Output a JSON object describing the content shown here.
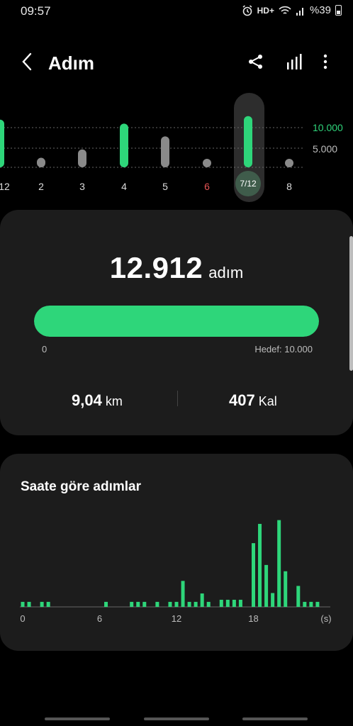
{
  "status": {
    "time": "09:57",
    "network": "HD+",
    "battery": "%39"
  },
  "header": {
    "title": "Adım",
    "icons": [
      "chevron-left-icon",
      "share-icon",
      "bar-chart-icon",
      "more-vertical-icon"
    ]
  },
  "week": {
    "goal_label": "10.000",
    "half_label": "5.000",
    "days": [
      {
        "label": "12",
        "steps": 12000,
        "goal_met": true,
        "red": false
      },
      {
        "label": "2",
        "steps": 2400,
        "goal_met": false,
        "red": false
      },
      {
        "label": "3",
        "steps": 4500,
        "goal_met": false,
        "red": false
      },
      {
        "label": "4",
        "steps": 11000,
        "goal_met": true,
        "red": false
      },
      {
        "label": "5",
        "steps": 7800,
        "goal_met": false,
        "red": false
      },
      {
        "label": "6",
        "steps": 0,
        "goal_met": false,
        "red": true
      },
      {
        "label": "7/12",
        "steps": 12912,
        "goal_met": true,
        "red": false,
        "selected": true
      },
      {
        "label": "8",
        "steps": 0,
        "goal_met": false,
        "red": false
      }
    ]
  },
  "today": {
    "steps": "12.912",
    "unit": "adım",
    "progress_fraction": 1.0,
    "progress_min_label": "0",
    "goal_label": "Hedef: 10.000",
    "distance_value": "9,04",
    "distance_unit": "km",
    "calories_value": "407",
    "calories_unit": "Kal"
  },
  "hourly": {
    "title": "Saate göre adımlar",
    "x_ticks": [
      "0",
      "6",
      "12",
      "18"
    ],
    "x_unit": "(s)",
    "colors": {
      "bar": "#2ed67a",
      "axis": "#666666"
    }
  },
  "chart_data": {
    "type": "bar",
    "title": "Saate göre adımlar",
    "xlabel": "(s)",
    "x": [
      0,
      0.5,
      1.5,
      2,
      6.5,
      8.5,
      9,
      9.5,
      10.5,
      11.5,
      12,
      12.5,
      13,
      13.5,
      14,
      14.5,
      15.5,
      16,
      16.5,
      17,
      18,
      18.5,
      19,
      19.5,
      20,
      20.5,
      21.5,
      22,
      22.5,
      23
    ],
    "values": [
      120,
      120,
      120,
      120,
      120,
      120,
      120,
      120,
      120,
      120,
      120,
      620,
      120,
      120,
      320,
      120,
      170,
      170,
      170,
      170,
      1520,
      1980,
      1000,
      330,
      2070,
      850,
      500,
      120,
      120,
      120
    ],
    "xlim": [
      0,
      24
    ],
    "ylim": [
      0,
      2300
    ]
  }
}
